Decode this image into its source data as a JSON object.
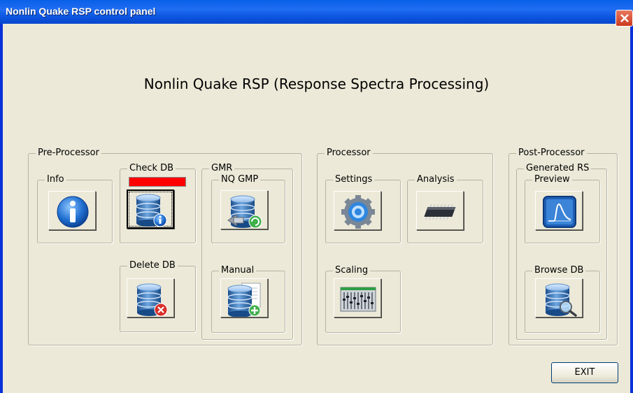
{
  "window": {
    "title": "Nonlin Quake RSP control panel"
  },
  "heading": "Nonlin Quake RSP (Response Spectra Processing)",
  "pre_processor": {
    "label": "Pre-Processor",
    "info": {
      "label": "Info",
      "icon": "info-icon"
    },
    "check_db": {
      "label": "Check DB",
      "icon": "database-info-icon",
      "status_color": "#ff0000"
    },
    "delete_db": {
      "label": "Delete DB",
      "icon": "database-delete-icon"
    },
    "gmr": {
      "label": "GMR",
      "nq_gmp": {
        "label": "NQ GMP",
        "icon": "database-import-icon"
      },
      "manual": {
        "label": "Manual",
        "icon": "database-add-icon"
      }
    }
  },
  "processor": {
    "label": "Processor",
    "settings": {
      "label": "Settings",
      "icon": "gear-icon"
    },
    "analysis": {
      "label": "Analysis",
      "icon": "chip-icon"
    },
    "scaling": {
      "label": "Scaling",
      "icon": "equalizer-icon"
    }
  },
  "post_processor": {
    "label": "Post-Processor",
    "generated_rs": {
      "label": "Generated RS",
      "preview": {
        "label": "Preview",
        "icon": "spectrum-chart-icon"
      },
      "browse_db": {
        "label": "Browse DB",
        "icon": "database-search-icon"
      }
    }
  },
  "exit_label": "EXIT"
}
